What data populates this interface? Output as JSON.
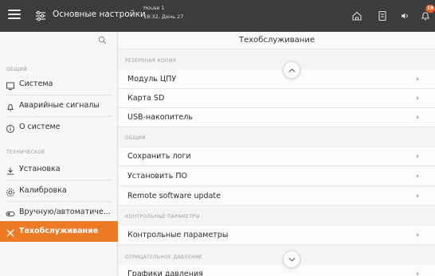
{
  "header": {
    "title": "Основные настройки",
    "house_name": "House 1",
    "house_time": "18:32, День 27",
    "notification_count": "19"
  },
  "sidebar": {
    "sections": [
      {
        "label": "ОБЩИЙ",
        "items": [
          {
            "label": "Система",
            "icon": "system-icon"
          },
          {
            "label": "Аварийные сигналы",
            "icon": "bell-icon"
          },
          {
            "label": "О системе",
            "icon": "info-icon"
          }
        ]
      },
      {
        "label": "ТЕХНИЧЕСКОЕ",
        "items": [
          {
            "label": "Установка",
            "icon": "install-icon"
          },
          {
            "label": "Калибровка",
            "icon": "calibration-icon"
          },
          {
            "label": "Вручную/автоматиче...",
            "icon": "toggle-icon"
          },
          {
            "label": "Техобслуживание",
            "icon": "tools-icon",
            "active": true
          }
        ]
      }
    ]
  },
  "main": {
    "title": "Техобслуживание",
    "sections": [
      {
        "label": "РЕЗЕРВНАЯ КОПИЯ",
        "rows": [
          "Модуль ЦПУ",
          "Карта SD",
          "USB-накопитель"
        ]
      },
      {
        "label": "ОБЩИЙ",
        "rows": [
          "Сохранить логи",
          "Установить ПО",
          "Remote software update"
        ]
      },
      {
        "label": "КОНТРОЛЬНЫЕ ПАРАМЕТРЫ",
        "rows": [
          "Контрольные параметры"
        ]
      },
      {
        "label": "ОТРИЦАТЕЛЬНОЕ ДАВЛЕНИЕ",
        "rows": [
          "Графики давления"
        ]
      }
    ]
  },
  "colors": {
    "header_bg": "#3c3c3c",
    "accent": "#ef7a26",
    "badge": "#e85a20"
  }
}
